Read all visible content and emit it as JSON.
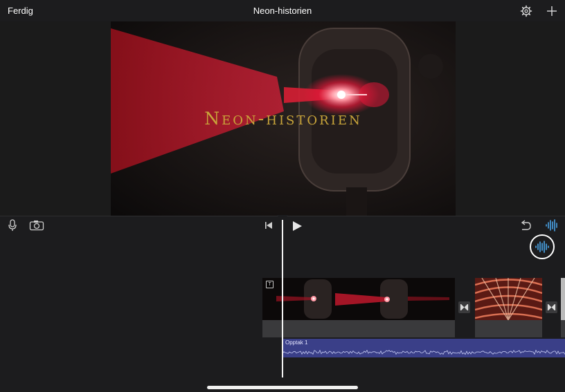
{
  "topbar": {
    "done_label": "Ferdig",
    "project_title": "Neon-historien",
    "settings_icon": "gear-icon",
    "add_icon": "plus-icon"
  },
  "viewer": {
    "overlay_title": "Neon-historien"
  },
  "controls": {
    "mic_icon": "microphone-icon",
    "camera_icon": "camera-icon",
    "skip_icon": "skip-to-start-icon",
    "play_icon": "play-icon",
    "undo_icon": "undo-icon",
    "audio_icon": "waveform-icon"
  },
  "timeline": {
    "audio_clip_label": "Opptak 1"
  },
  "colors": {
    "accent": "#4fb3ff",
    "title_gold": "#c9a53a",
    "audio_track": "#3a3f88"
  }
}
